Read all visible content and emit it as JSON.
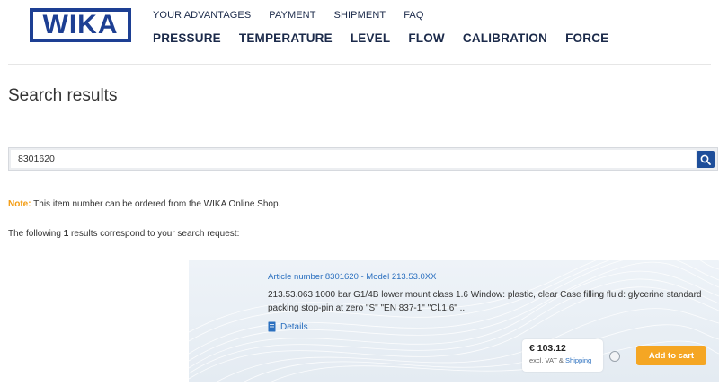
{
  "brand": {
    "logo_text": "WIKA"
  },
  "topnav": [
    "YOUR ADVANTAGES",
    "PAYMENT",
    "SHIPMENT",
    "FAQ"
  ],
  "mainnav": [
    "PRESSURE",
    "TEMPERATURE",
    "LEVEL",
    "FLOW",
    "CALIBRATION",
    "FORCE"
  ],
  "page": {
    "title": "Search results"
  },
  "search": {
    "value": "8301620",
    "icon": "search-icon"
  },
  "note": {
    "label": "Note:",
    "text": " This item number can be ordered from the WIKA Online Shop."
  },
  "results": {
    "prefix": "The following ",
    "count": "1",
    "suffix": " results correspond to your search request:"
  },
  "result": {
    "article": "Article number 8301620 - Model 213.53.0XX",
    "description": "213.53.063 1000 bar G1/4B lower mount class 1.6 Window: plastic, clear Case filling fluid: glycerine standard packing stop-pin at zero \"S\" \"EN 837-1\" \"Cl.1.6\" ...",
    "details_label": "Details",
    "details_icon": "document-icon",
    "price": "€ 103.12",
    "price_note": "excl. VAT & ",
    "shipping_link": "Shipping",
    "add_to_cart": "Add to cart"
  },
  "colors": {
    "brand_blue": "#1d3f93",
    "link_blue": "#2a6fbf",
    "note_orange": "#f39c12",
    "cart_orange": "#f5a623"
  }
}
